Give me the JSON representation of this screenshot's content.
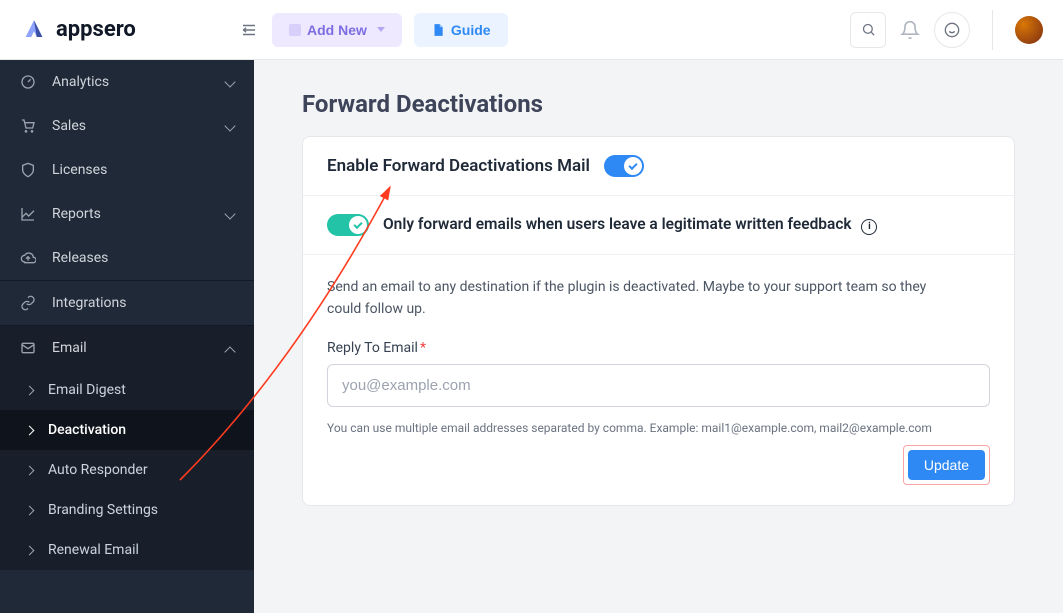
{
  "brand": {
    "name": "appsero"
  },
  "topbar": {
    "add_new": "Add New",
    "guide": "Guide"
  },
  "sidebar": {
    "analytics": "Analytics",
    "sales": "Sales",
    "licenses": "Licenses",
    "reports": "Reports",
    "releases": "Releases",
    "integrations": "Integrations",
    "email": "Email",
    "email_sub": {
      "digest": "Email Digest",
      "deactivation": "Deactivation",
      "autoresponder": "Auto Responder",
      "branding": "Branding Settings",
      "renewal": "Renewal Email"
    }
  },
  "page": {
    "title": "Forward Deactivations",
    "enable_label": "Enable Forward Deactivations Mail",
    "only_forward_label": "Only forward emails when users leave a legitimate written feedback",
    "desc": "Send an email to any destination if the plugin is deactivated. Maybe to your support team so they could follow up.",
    "reply_to_label": "Reply To Email",
    "reply_to_placeholder": "you@example.com",
    "reply_to_value": "",
    "hint": "You can use multiple email addresses separated by comma. Example: mail1@example.com, mail2@example.com",
    "update": "Update",
    "enable_on": true,
    "only_forward_on": true
  },
  "colors": {
    "accent": "#2f89f5",
    "accent_green": "#22c3a6",
    "danger": "#ef4444"
  }
}
